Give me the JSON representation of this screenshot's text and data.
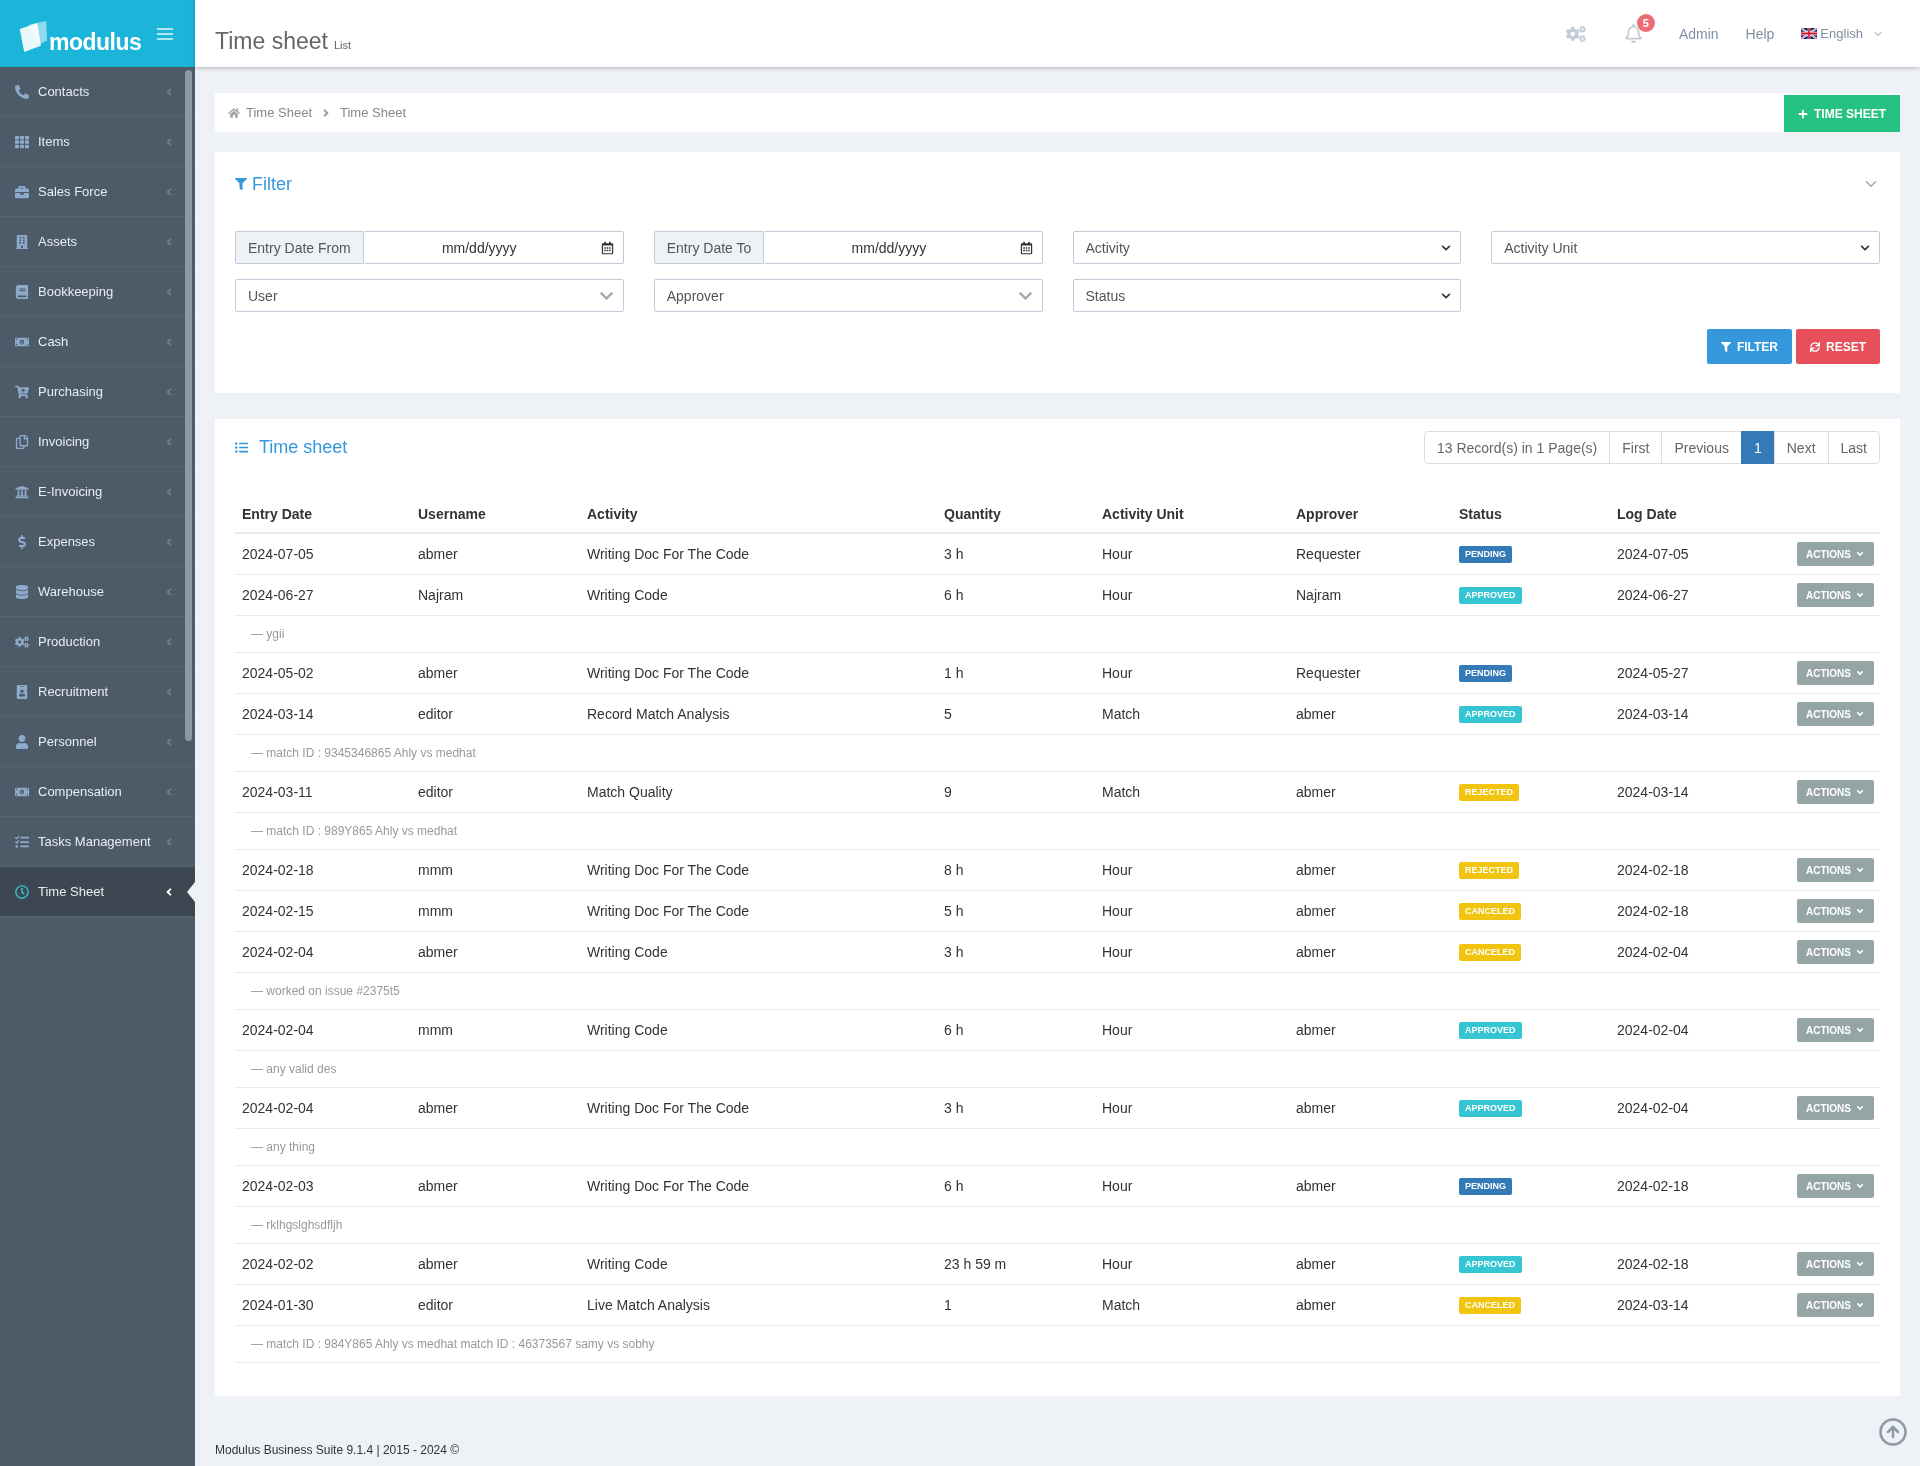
{
  "sidebar": {
    "logo": "modulus",
    "items": [
      {
        "label": "Contacts",
        "selected": false
      },
      {
        "label": "Items",
        "selected": false
      },
      {
        "label": "Sales Force",
        "selected": false
      },
      {
        "label": "Assets",
        "selected": false
      },
      {
        "label": "Bookkeeping",
        "selected": false
      },
      {
        "label": "Cash",
        "selected": false
      },
      {
        "label": "Purchasing",
        "selected": false
      },
      {
        "label": "Invoicing",
        "selected": false
      },
      {
        "label": "E-Invoicing",
        "selected": false
      },
      {
        "label": "Expenses",
        "selected": false
      },
      {
        "label": "Warehouse",
        "selected": false
      },
      {
        "label": "Production",
        "selected": false
      },
      {
        "label": "Recruitment",
        "selected": false
      },
      {
        "label": "Personnel",
        "selected": false
      },
      {
        "label": "Compensation",
        "selected": false
      },
      {
        "label": "Tasks Management",
        "selected": false
      },
      {
        "label": "Time Sheet",
        "selected": true
      }
    ]
  },
  "header": {
    "title": "Time sheet",
    "subtitle": "List",
    "notifications": "5",
    "links": [
      "Admin",
      "Help"
    ],
    "language": "English"
  },
  "breadcrumb": {
    "items": [
      "Time Sheet",
      "Time Sheet"
    ],
    "add_button": "TIME SHEET"
  },
  "filter": {
    "title": "Filter",
    "fields": [
      {
        "kind": "date",
        "label": "Entry Date From",
        "placeholder": "mm/dd/yyyy"
      },
      {
        "kind": "date",
        "label": "Entry Date To",
        "placeholder": "mm/dd/yyyy"
      },
      {
        "kind": "select",
        "placeholder": "Activity"
      },
      {
        "kind": "select",
        "placeholder": "Activity Unit"
      },
      {
        "kind": "combo",
        "placeholder": "User"
      },
      {
        "kind": "combo",
        "placeholder": "Approver"
      },
      {
        "kind": "select",
        "placeholder": "Status"
      }
    ],
    "buttons": [
      {
        "kind": "filter",
        "label": "FILTER"
      },
      {
        "kind": "reset",
        "label": "RESET"
      }
    ]
  },
  "table": {
    "title": "Time sheet",
    "pagination": {
      "info": "13 Record(s) in 1 Page(s)",
      "pages": [
        {
          "label": "First",
          "selected": false
        },
        {
          "label": "Previous",
          "selected": false
        },
        {
          "label": "1",
          "selected": true
        },
        {
          "label": "Next",
          "selected": false
        },
        {
          "label": "Last",
          "selected": false
        }
      ]
    },
    "columns": [
      "Entry Date",
      "Username",
      "Activity",
      "Quantity",
      "Activity Unit",
      "Approver",
      "Status",
      "Log Date"
    ],
    "rows": [
      {
        "kind": "entry",
        "entry_date": "2024-07-05",
        "username": "abmer",
        "activity": "Writing Doc For The Code",
        "quantity": "3 h",
        "activity_unit": "Hour",
        "approver": "Requester",
        "status": {
          "label": "PENDING",
          "color": "#337ab7"
        },
        "log_date": "2024-07-05",
        "action": "ACTIONS"
      },
      {
        "kind": "entry",
        "entry_date": "2024-06-27",
        "username": "Najram",
        "activity": "Writing Code",
        "quantity": "6 h",
        "activity_unit": "Hour",
        "approver": "Najram",
        "status": {
          "label": "APPROVED",
          "color": "#36c6d3"
        },
        "log_date": "2024-06-27",
        "action": "ACTIONS"
      },
      {
        "kind": "note",
        "text": "— ygii"
      },
      {
        "kind": "entry",
        "entry_date": "2024-05-02",
        "username": "abmer",
        "activity": "Writing Doc For The Code",
        "quantity": "1 h",
        "activity_unit": "Hour",
        "approver": "Requester",
        "status": {
          "label": "PENDING",
          "color": "#337ab7"
        },
        "log_date": "2024-05-27",
        "action": "ACTIONS"
      },
      {
        "kind": "entry",
        "entry_date": "2024-03-14",
        "username": "editor",
        "activity": "Record Match Analysis",
        "quantity": "5",
        "activity_unit": "Match",
        "approver": "abmer",
        "status": {
          "label": "APPROVED",
          "color": "#36c6d3"
        },
        "log_date": "2024-03-14",
        "action": "ACTIONS"
      },
      {
        "kind": "note",
        "text": "— match ID : 9345346865 Ahly vs medhat"
      },
      {
        "kind": "entry",
        "entry_date": "2024-03-11",
        "username": "editor",
        "activity": "Match Quality",
        "quantity": "9",
        "activity_unit": "Match",
        "approver": "abmer",
        "status": {
          "label": "REJECTED",
          "color": "#f1c40f"
        },
        "log_date": "2024-03-14",
        "action": "ACTIONS"
      },
      {
        "kind": "note",
        "text": "— match ID : 989Y865 Ahly vs medhat"
      },
      {
        "kind": "entry",
        "entry_date": "2024-02-18",
        "username": "mmm",
        "activity": "Writing Doc For The Code",
        "quantity": "8 h",
        "activity_unit": "Hour",
        "approver": "abmer",
        "status": {
          "label": "REJECTED",
          "color": "#f1c40f"
        },
        "log_date": "2024-02-18",
        "action": "ACTIONS"
      },
      {
        "kind": "entry",
        "entry_date": "2024-02-15",
        "username": "mmm",
        "activity": "Writing Doc For The Code",
        "quantity": "5 h",
        "activity_unit": "Hour",
        "approver": "abmer",
        "status": {
          "label": "CANCELED",
          "color": "#f1c40f"
        },
        "log_date": "2024-02-18",
        "action": "ACTIONS"
      },
      {
        "kind": "entry",
        "entry_date": "2024-02-04",
        "username": "abmer",
        "activity": "Writing Code",
        "quantity": "3 h",
        "activity_unit": "Hour",
        "approver": "abmer",
        "status": {
          "label": "CANCELED",
          "color": "#f1c40f"
        },
        "log_date": "2024-02-04",
        "action": "ACTIONS"
      },
      {
        "kind": "note",
        "text": "— worked on issue #2375t5"
      },
      {
        "kind": "entry",
        "entry_date": "2024-02-04",
        "username": "mmm",
        "activity": "Writing Code",
        "quantity": "6 h",
        "activity_unit": "Hour",
        "approver": "abmer",
        "status": {
          "label": "APPROVED",
          "color": "#36c6d3"
        },
        "log_date": "2024-02-04",
        "action": "ACTIONS"
      },
      {
        "kind": "note",
        "text": "— any valid des"
      },
      {
        "kind": "entry",
        "entry_date": "2024-02-04",
        "username": "abmer",
        "activity": "Writing Doc For The Code",
        "quantity": "3 h",
        "activity_unit": "Hour",
        "approver": "abmer",
        "status": {
          "label": "APPROVED",
          "color": "#36c6d3"
        },
        "log_date": "2024-02-04",
        "action": "ACTIONS"
      },
      {
        "kind": "note",
        "text": "— any thing"
      },
      {
        "kind": "entry",
        "entry_date": "2024-02-03",
        "username": "abmer",
        "activity": "Writing Doc For The Code",
        "quantity": "6 h",
        "activity_unit": "Hour",
        "approver": "abmer",
        "status": {
          "label": "PENDING",
          "color": "#337ab7"
        },
        "log_date": "2024-02-18",
        "action": "ACTIONS"
      },
      {
        "kind": "note",
        "text": "— rklhgslghsdfljh"
      },
      {
        "kind": "entry",
        "entry_date": "2024-02-02",
        "username": "abmer",
        "activity": "Writing Code",
        "quantity": "23 h 59 m",
        "activity_unit": "Hour",
        "approver": "abmer",
        "status": {
          "label": "APPROVED",
          "color": "#36c6d3"
        },
        "log_date": "2024-02-18",
        "action": "ACTIONS"
      },
      {
        "kind": "entry",
        "entry_date": "2024-01-30",
        "username": "editor",
        "activity": "Live Match Analysis",
        "quantity": "1",
        "activity_unit": "Match",
        "approver": "abmer",
        "status": {
          "label": "CANCELED",
          "color": "#f1c40f"
        },
        "log_date": "2024-03-14",
        "action": "ACTIONS"
      },
      {
        "kind": "note",
        "text": "— match ID : 984Y865 Ahly vs medhat match ID : 46373567 samy vs sobhy"
      }
    ]
  },
  "footer": "Modulus Business Suite 9.1.4 | 2015 - 2024 ©"
}
